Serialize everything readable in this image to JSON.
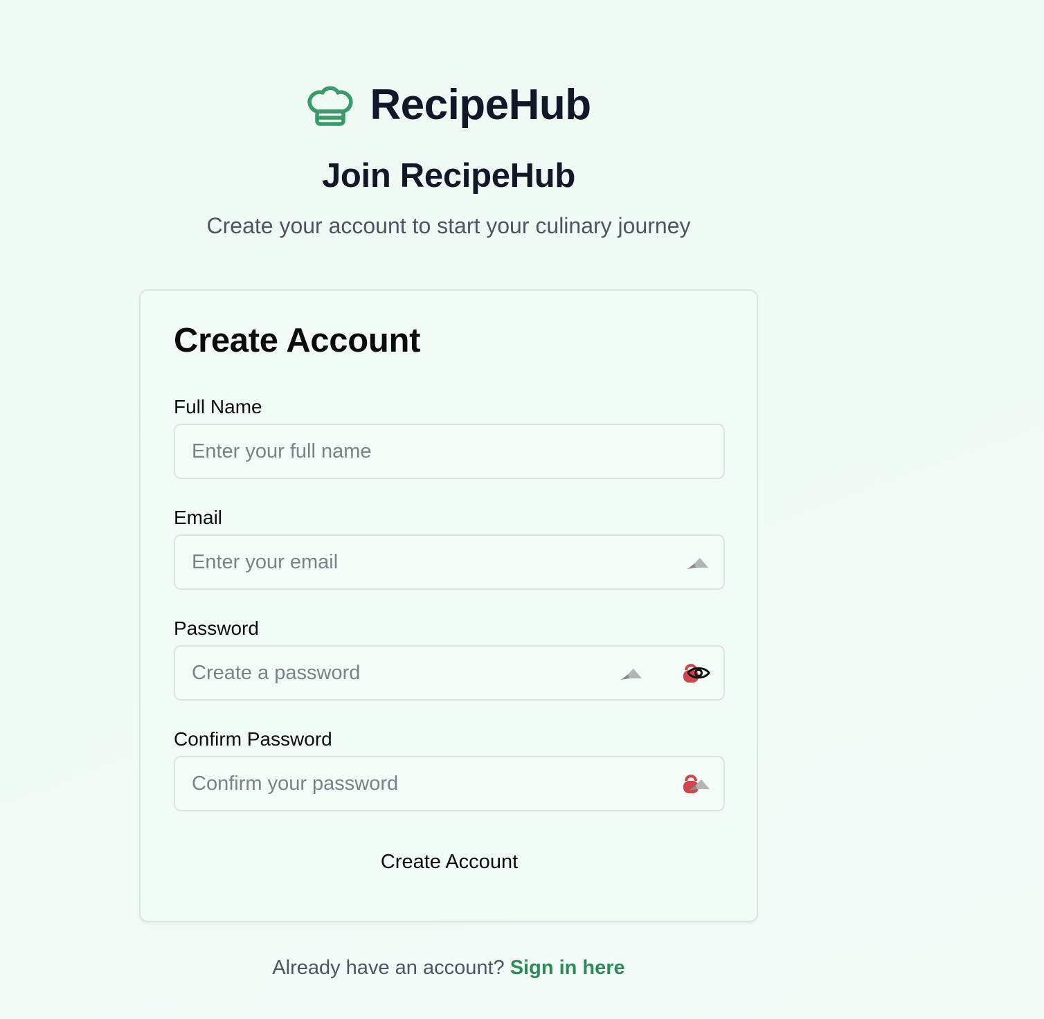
{
  "brand": {
    "name": "RecipeHub",
    "icon": "chef-hat-icon",
    "accent_color": "#3a9a68"
  },
  "hero": {
    "title": "Join RecipeHub",
    "subtitle": "Create your account to start your culinary journey"
  },
  "form": {
    "title": "Create Account",
    "fields": [
      {
        "label": "Full Name",
        "value": "",
        "placeholder": "Enter your full name"
      },
      {
        "label": "Email",
        "value": "",
        "placeholder": "Enter your email"
      },
      {
        "label": "Password",
        "value": "",
        "placeholder": "Create a password"
      },
      {
        "label": "Confirm Password",
        "value": "",
        "placeholder": "Confirm your password"
      }
    ],
    "submit_label": "Create Account"
  },
  "footer": {
    "prompt": "Already have an account?",
    "link_label": "Sign in here",
    "link_color": "#2e8b57"
  }
}
